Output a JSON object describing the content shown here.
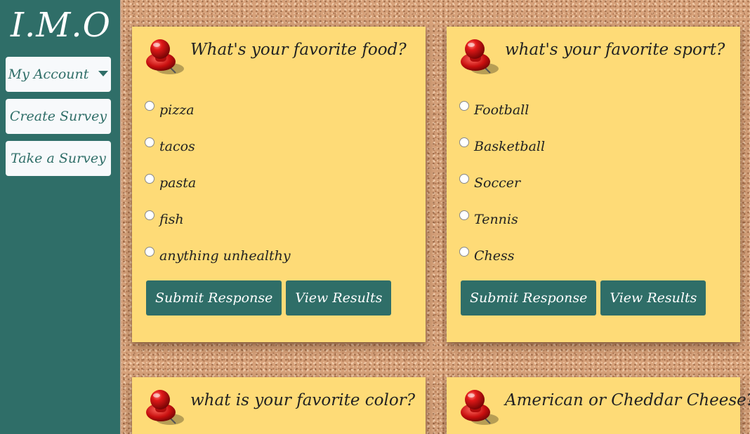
{
  "app": {
    "logo": "I.M.O"
  },
  "sidebar": {
    "items": [
      {
        "label": "My Account",
        "has_dropdown": true
      },
      {
        "label": "Create Survey"
      },
      {
        "label": "Take a Survey"
      }
    ]
  },
  "surveys": [
    {
      "question": "What's your favorite food?",
      "options": [
        "pizza",
        "tacos",
        "pasta",
        "fish",
        "anything unhealthy"
      ],
      "submit_label": "Submit Response",
      "results_label": "View Results"
    },
    {
      "question": "what's your favorite sport?",
      "options": [
        "Football",
        "Basketball",
        "Soccer",
        "Tennis",
        "Chess"
      ],
      "submit_label": "Submit Response",
      "results_label": "View Results"
    },
    {
      "question": "what is your favorite color?",
      "options": [],
      "submit_label": "",
      "results_label": ""
    },
    {
      "question": "American or Cheddar Cheese?",
      "options": [],
      "submit_label": "",
      "results_label": ""
    }
  ],
  "colors": {
    "sidebar": "#2f6e68",
    "card": "#fedb77",
    "button": "#2f6e68",
    "pin": "#cc1111"
  },
  "icons": {
    "pin": "pushpin-icon",
    "dropdown": "caret-down-icon"
  }
}
